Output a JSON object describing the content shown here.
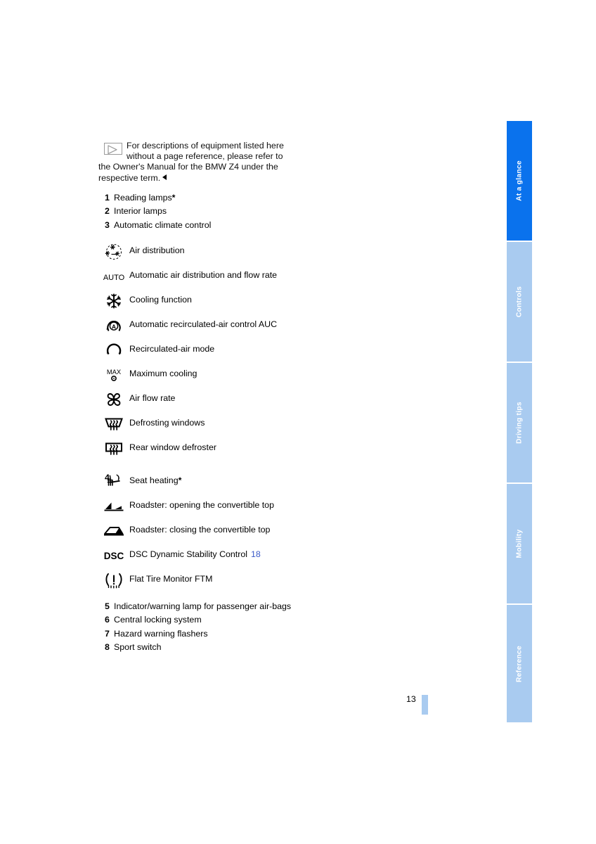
{
  "document": {
    "page_number": "13",
    "note": {
      "icon": "play-triangle-icon",
      "text": "For descriptions of equipment listed here without a page reference, please refer to the Owner's Manual for the BMW Z4 under the respective term."
    },
    "items": [
      {
        "num": "1",
        "label": "Reading lamps",
        "asterisk": "*"
      },
      {
        "num": "2",
        "label": "Interior lamps",
        "asterisk": ""
      },
      {
        "num": "3",
        "label": "Automatic climate control",
        "asterisk": ""
      }
    ],
    "climate_icons": [
      {
        "icon": "air-distribution-icon",
        "label": "Air distribution"
      },
      {
        "icon": "auto-text-icon",
        "label": "Automatic air distribution and flow rate"
      },
      {
        "icon": "snowflake-icon",
        "label": "Cooling function"
      },
      {
        "icon": "auc-recirculation-icon",
        "label": "Automatic recirculated-air control AUC"
      },
      {
        "icon": "recirculated-air-icon",
        "label": "Recirculated-air mode"
      },
      {
        "icon": "max-cooling-icon",
        "label": "Maximum cooling"
      },
      {
        "icon": "fan-icon",
        "label": "Air flow rate"
      },
      {
        "icon": "defrost-windshield-icon",
        "label": "Defrosting windows"
      },
      {
        "icon": "defrost-rear-window-icon",
        "label": "Rear window defroster"
      }
    ],
    "group4": {
      "num": "4",
      "rows": [
        {
          "icon": "seat-heating-icon",
          "label": "Seat heating",
          "asterisk": "*",
          "pageref": ""
        },
        {
          "icon": "convertible-top-open-icon",
          "label": "Roadster: opening the convertible top",
          "asterisk": "",
          "pageref": ""
        },
        {
          "icon": "convertible-top-close-icon",
          "label": "Roadster: closing the convertible top",
          "asterisk": "",
          "pageref": ""
        },
        {
          "icon": "dsc-text-icon",
          "label": "DSC Dynamic Stability Control",
          "asterisk": "",
          "pageref": "18"
        },
        {
          "icon": "flat-tire-monitor-icon",
          "label": "Flat Tire Monitor FTM",
          "asterisk": "",
          "pageref": ""
        }
      ]
    },
    "items_tail": [
      {
        "num": "5",
        "label": "Indicator/warning lamp for passenger air-bags",
        "asterisk": ""
      },
      {
        "num": "6",
        "label": "Central locking system",
        "asterisk": ""
      },
      {
        "num": "7",
        "label": "Hazard warning flashers",
        "asterisk": ""
      },
      {
        "num": "8",
        "label": "Sport switch",
        "asterisk": ""
      }
    ]
  },
  "tabs": [
    {
      "label": "At a glance",
      "active": true
    },
    {
      "label": "Controls",
      "active": false
    },
    {
      "label": "Driving tips",
      "active": false
    },
    {
      "label": "Mobility",
      "active": false
    },
    {
      "label": "Reference",
      "active": false
    }
  ],
  "colors": {
    "tab_active": "#0a72ed",
    "tab_inactive": "#a9cbf0",
    "page_marker": "#a9cbf0",
    "page_reference_link": "#3a59c8",
    "page_background": "#ffffff"
  }
}
